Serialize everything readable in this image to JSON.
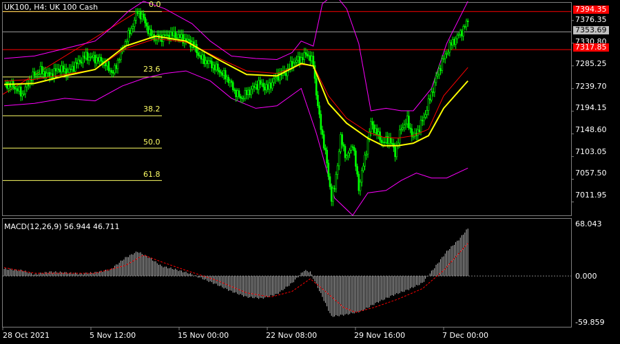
{
  "window": {
    "title": "UK100, H4:  UK 100 Cash"
  },
  "colors": {
    "background": "#000000",
    "candle": "#00ff00",
    "ma_fast": "#ffff00",
    "ma_slow": "#ff0000",
    "bollinger": "#ff00ff",
    "fib": "#ffff66",
    "level_red": "#ff0000",
    "level_gray": "#a0a0a0",
    "macd_hist": "#c0c0c0",
    "macd_signal": "#ff0000"
  },
  "price_axis": {
    "ticks": [
      "7376.35",
      "7330.80",
      "7285.25",
      "7239.70",
      "7194.15",
      "7148.60",
      "7103.05",
      "7057.50",
      "7011.95"
    ],
    "badges": {
      "top_red": "7394.35",
      "current": "7353.69",
      "low_red": "7317.85"
    }
  },
  "fibonacci": {
    "levels": [
      "0.0",
      "23.6",
      "38.2",
      "50.0",
      "61.8"
    ]
  },
  "macd": {
    "label": "MACD(12,26,9) 56.944 46.711",
    "ticks": [
      "68.043",
      "0.000",
      "-59.859"
    ]
  },
  "time_axis": {
    "labels": [
      "28 Oct 2021",
      "5 Nov 12:00",
      "15 Nov 00:00",
      "22 Nov 08:00",
      "29 Nov 16:00",
      "7 Dec 00:00"
    ]
  },
  "chart_data": [
    {
      "type": "candlestick",
      "title": "UK100, H4:  UK 100 Cash",
      "x_labels": [
        "28 Oct 2021",
        "5 Nov 12:00",
        "15 Nov 00:00",
        "22 Nov 08:00",
        "29 Nov 16:00",
        "7 Dec 00:00"
      ],
      "ylim": [
        6985,
        7412
      ],
      "y_ticks": [
        7376.35,
        7330.8,
        7285.25,
        7239.7,
        7194.15,
        7148.6,
        7103.05,
        7057.5,
        7011.95
      ],
      "close_path": [
        [
          0,
          7250
        ],
        [
          6,
          7245
        ],
        [
          12,
          7228
        ],
        [
          18,
          7262
        ],
        [
          24,
          7275
        ],
        [
          30,
          7265
        ],
        [
          36,
          7280
        ],
        [
          42,
          7272
        ],
        [
          48,
          7290
        ],
        [
          54,
          7305
        ],
        [
          60,
          7300
        ],
        [
          66,
          7292
        ],
        [
          72,
          7270
        ],
        [
          78,
          7320
        ],
        [
          84,
          7360
        ],
        [
          88,
          7395
        ],
        [
          92,
          7380
        ],
        [
          96,
          7350
        ],
        [
          100,
          7340
        ],
        [
          106,
          7345
        ],
        [
          112,
          7348
        ],
        [
          118,
          7340
        ],
        [
          124,
          7330
        ],
        [
          130,
          7300
        ],
        [
          136,
          7290
        ],
        [
          142,
          7275
        ],
        [
          148,
          7258
        ],
        [
          152,
          7235
        ],
        [
          156,
          7220
        ],
        [
          162,
          7235
        ],
        [
          168,
          7250
        ],
        [
          174,
          7240
        ],
        [
          180,
          7265
        ],
        [
          186,
          7272
        ],
        [
          190,
          7290
        ],
        [
          196,
          7300
        ],
        [
          200,
          7310
        ],
        [
          204,
          7290
        ],
        [
          206,
          7230
        ],
        [
          208,
          7180
        ],
        [
          212,
          7110
        ],
        [
          216,
          7020
        ],
        [
          218,
          7040
        ],
        [
          222,
          7140
        ],
        [
          226,
          7100
        ],
        [
          230,
          7130
        ],
        [
          234,
          7040
        ],
        [
          238,
          7100
        ],
        [
          242,
          7170
        ],
        [
          246,
          7150
        ],
        [
          250,
          7130
        ],
        [
          254,
          7140
        ],
        [
          258,
          7110
        ],
        [
          262,
          7160
        ],
        [
          266,
          7175
        ],
        [
          270,
          7140
        ],
        [
          274,
          7160
        ],
        [
          278,
          7190
        ],
        [
          282,
          7230
        ],
        [
          286,
          7270
        ],
        [
          290,
          7300
        ],
        [
          294,
          7325
        ],
        [
          298,
          7340
        ],
        [
          302,
          7355
        ],
        [
          306,
          7375
        ]
      ],
      "ma_fast": [
        [
          0,
          7248
        ],
        [
          20,
          7250
        ],
        [
          40,
          7265
        ],
        [
          60,
          7278
        ],
        [
          80,
          7325
        ],
        [
          100,
          7345
        ],
        [
          120,
          7335
        ],
        [
          140,
          7300
        ],
        [
          160,
          7268
        ],
        [
          180,
          7265
        ],
        [
          196,
          7290
        ],
        [
          204,
          7285
        ],
        [
          214,
          7210
        ],
        [
          226,
          7170
        ],
        [
          240,
          7140
        ],
        [
          250,
          7125
        ],
        [
          260,
          7125
        ],
        [
          270,
          7130
        ],
        [
          280,
          7145
        ],
        [
          290,
          7200
        ],
        [
          306,
          7255
        ]
      ],
      "ma_slow": [
        [
          0,
          7255
        ],
        [
          20,
          7258
        ],
        [
          40,
          7268
        ],
        [
          60,
          7278
        ],
        [
          80,
          7320
        ],
        [
          100,
          7340
        ],
        [
          120,
          7333
        ],
        [
          140,
          7303
        ],
        [
          160,
          7275
        ],
        [
          180,
          7270
        ],
        [
          196,
          7288
        ],
        [
          204,
          7286
        ],
        [
          214,
          7225
        ],
        [
          226,
          7180
        ],
        [
          240,
          7152
        ],
        [
          250,
          7142
        ],
        [
          260,
          7140
        ],
        [
          270,
          7145
        ],
        [
          280,
          7158
        ],
        [
          290,
          7225
        ],
        [
          306,
          7282
        ]
      ],
      "bollinger_upper": [
        [
          0,
          7300
        ],
        [
          20,
          7305
        ],
        [
          40,
          7320
        ],
        [
          60,
          7335
        ],
        [
          70,
          7360
        ],
        [
          82,
          7395
        ],
        [
          92,
          7415
        ],
        [
          106,
          7400
        ],
        [
          124,
          7370
        ],
        [
          136,
          7335
        ],
        [
          150,
          7305
        ],
        [
          166,
          7300
        ],
        [
          180,
          7298
        ],
        [
          190,
          7312
        ],
        [
          196,
          7335
        ],
        [
          204,
          7325
        ],
        [
          210,
          7410
        ],
        [
          218,
          7430
        ],
        [
          226,
          7400
        ],
        [
          234,
          7330
        ],
        [
          242,
          7195
        ],
        [
          252,
          7200
        ],
        [
          262,
          7195
        ],
        [
          270,
          7195
        ],
        [
          282,
          7240
        ],
        [
          292,
          7330
        ],
        [
          306,
          7415
        ]
      ],
      "bollinger_lower": [
        [
          0,
          7205
        ],
        [
          20,
          7210
        ],
        [
          40,
          7220
        ],
        [
          60,
          7215
        ],
        [
          78,
          7245
        ],
        [
          92,
          7260
        ],
        [
          106,
          7270
        ],
        [
          120,
          7275
        ],
        [
          136,
          7255
        ],
        [
          150,
          7220
        ],
        [
          166,
          7200
        ],
        [
          180,
          7205
        ],
        [
          196,
          7240
        ],
        [
          206,
          7150
        ],
        [
          218,
          7020
        ],
        [
          230,
          6985
        ],
        [
          240,
          7030
        ],
        [
          252,
          7035
        ],
        [
          262,
          7055
        ],
        [
          272,
          7070
        ],
        [
          282,
          7060
        ],
        [
          292,
          7060
        ],
        [
          306,
          7080
        ]
      ],
      "levels": {
        "top_red": 7394.35,
        "current": 7353.69,
        "low_red": 7317.85
      },
      "fibonacci": [
        {
          "level": "0.0",
          "price": 7394.35
        },
        {
          "level": "23.6",
          "price": 7263
        },
        {
          "level": "38.2",
          "price": 7185
        },
        {
          "level": "50.0",
          "price": 7120
        },
        {
          "level": "61.8",
          "price": 7055
        }
      ]
    },
    {
      "type": "bar",
      "title": "MACD(12,26,9) 56.944 46.711",
      "ylim": [
        -59.859,
        68.043
      ],
      "y_ticks": [
        68.043,
        0,
        -59.859
      ],
      "macd_path": [
        [
          0,
          10
        ],
        [
          12,
          8
        ],
        [
          20,
          2
        ],
        [
          30,
          6
        ],
        [
          40,
          5
        ],
        [
          50,
          3
        ],
        [
          60,
          5
        ],
        [
          70,
          9
        ],
        [
          80,
          26
        ],
        [
          88,
          35
        ],
        [
          96,
          26
        ],
        [
          104,
          14
        ],
        [
          112,
          10
        ],
        [
          122,
          4
        ],
        [
          130,
          -3
        ],
        [
          140,
          -12
        ],
        [
          150,
          -22
        ],
        [
          160,
          -30
        ],
        [
          170,
          -32
        ],
        [
          180,
          -26
        ],
        [
          190,
          -10
        ],
        [
          198,
          8
        ],
        [
          202,
          6
        ],
        [
          210,
          -30
        ],
        [
          216,
          -58
        ],
        [
          226,
          -55
        ],
        [
          236,
          -50
        ],
        [
          246,
          -38
        ],
        [
          256,
          -28
        ],
        [
          266,
          -20
        ],
        [
          276,
          -10
        ],
        [
          284,
          12
        ],
        [
          292,
          35
        ],
        [
          300,
          52
        ],
        [
          306,
          68
        ]
      ],
      "signal_path": [
        [
          0,
          12
        ],
        [
          20,
          4
        ],
        [
          40,
          4
        ],
        [
          60,
          4
        ],
        [
          80,
          15
        ],
        [
          92,
          30
        ],
        [
          104,
          20
        ],
        [
          120,
          8
        ],
        [
          140,
          -6
        ],
        [
          160,
          -24
        ],
        [
          176,
          -30
        ],
        [
          190,
          -22
        ],
        [
          202,
          -4
        ],
        [
          212,
          -22
        ],
        [
          224,
          -45
        ],
        [
          232,
          -52
        ],
        [
          244,
          -45
        ],
        [
          260,
          -33
        ],
        [
          276,
          -18
        ],
        [
          290,
          8
        ],
        [
          306,
          46.711
        ]
      ]
    }
  ]
}
